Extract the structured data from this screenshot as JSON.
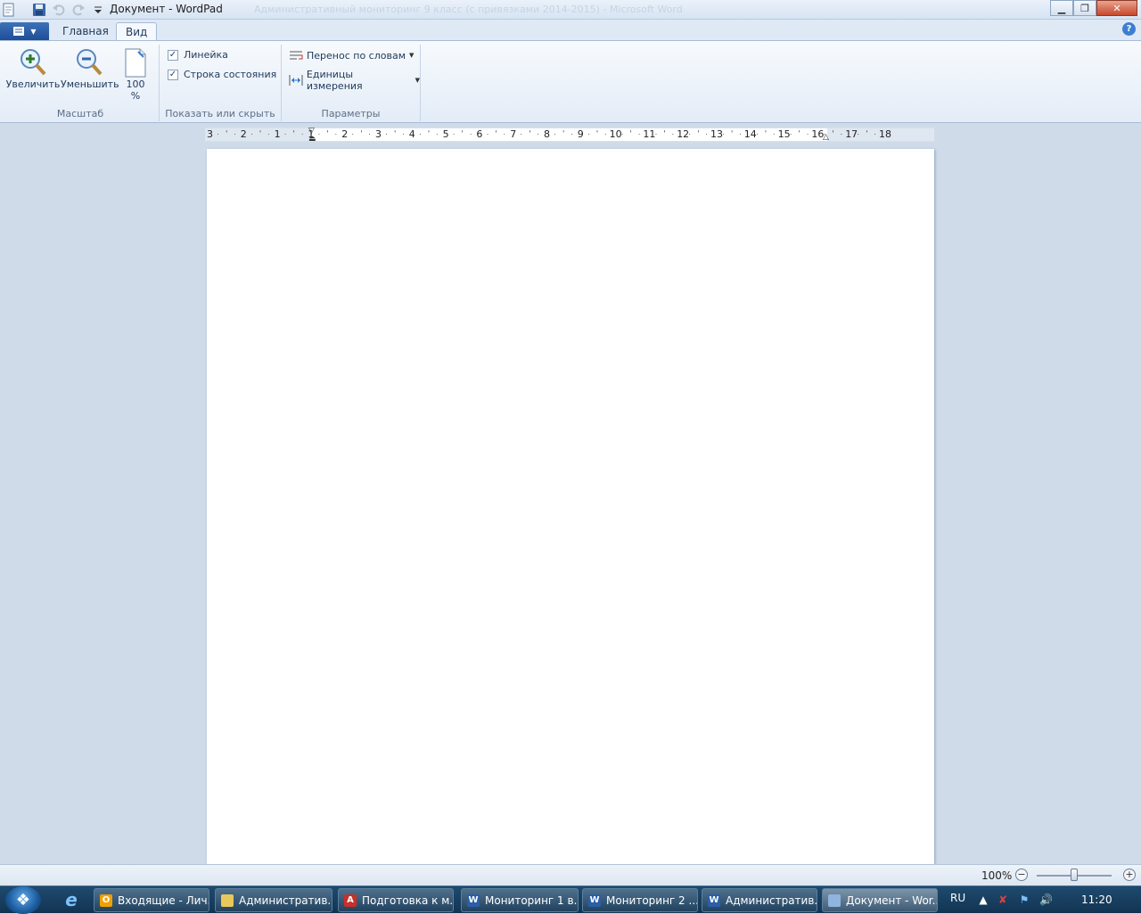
{
  "window": {
    "title": "Документ - WordPad",
    "background_title": "Административный мониторинг 9 класс (c привязками 2014-2015) - Microsoft Word"
  },
  "tabs": [
    {
      "label": "Главная",
      "active": false
    },
    {
      "label": "Вид",
      "active": true
    }
  ],
  "ribbon": {
    "zoom_group": {
      "label": "Масштаб",
      "zoom_in": "Увеличить",
      "zoom_out": "Уменьшить",
      "hundred": "100",
      "percent": "%"
    },
    "show_group": {
      "label": "Показать или скрыть",
      "ruler": {
        "label": "Линейка",
        "checked": true
      },
      "statusbar": {
        "label": "Строка состояния",
        "checked": true
      }
    },
    "params_group": {
      "label": "Параметры",
      "word_wrap": "Перенос по словам",
      "units": "Единицы измерения"
    }
  },
  "ruler": {
    "labels": [
      "3",
      "2",
      "1",
      "1",
      "2",
      "3",
      "4",
      "5",
      "6",
      "7",
      "8",
      "9",
      "10",
      "11",
      "12",
      "13",
      "14",
      "15",
      "16",
      "17",
      "18"
    ]
  },
  "status": {
    "zoom_percent": "100%",
    "zoom_minus": "−",
    "zoom_plus": "+",
    "zoom_value": 1.0
  },
  "taskbar": {
    "items": [
      {
        "label": "Входящие - Лич...",
        "icon": "outlook-icon",
        "color": "#f0a000",
        "glyph": "O",
        "active": false
      },
      {
        "label": "Административ...",
        "icon": "folder-icon",
        "color": "#e8c85a",
        "glyph": "",
        "active": false
      },
      {
        "label": "Подготовка к м...",
        "icon": "pdf-icon",
        "color": "#c8302a",
        "glyph": "A",
        "active": false
      },
      {
        "label": "Мониторинг 1 в...",
        "icon": "word-icon",
        "color": "#2b5ea8",
        "glyph": "W",
        "active": false
      },
      {
        "label": "Мониторинг 2 ...",
        "icon": "word-icon",
        "color": "#2b5ea8",
        "glyph": "W",
        "active": false
      },
      {
        "label": "Административ...",
        "icon": "word-icon",
        "color": "#2b5ea8",
        "glyph": "W",
        "active": false
      },
      {
        "label": "Документ - Wor...",
        "icon": "wordpad-icon",
        "color": "#8fb4de",
        "glyph": "",
        "active": true
      }
    ],
    "lang": "RU",
    "clock": "11:20"
  },
  "colors": {
    "ribbon_accent": "#1e395b",
    "app_menu": "#2a5ea6",
    "taskbar": "#17405f"
  }
}
